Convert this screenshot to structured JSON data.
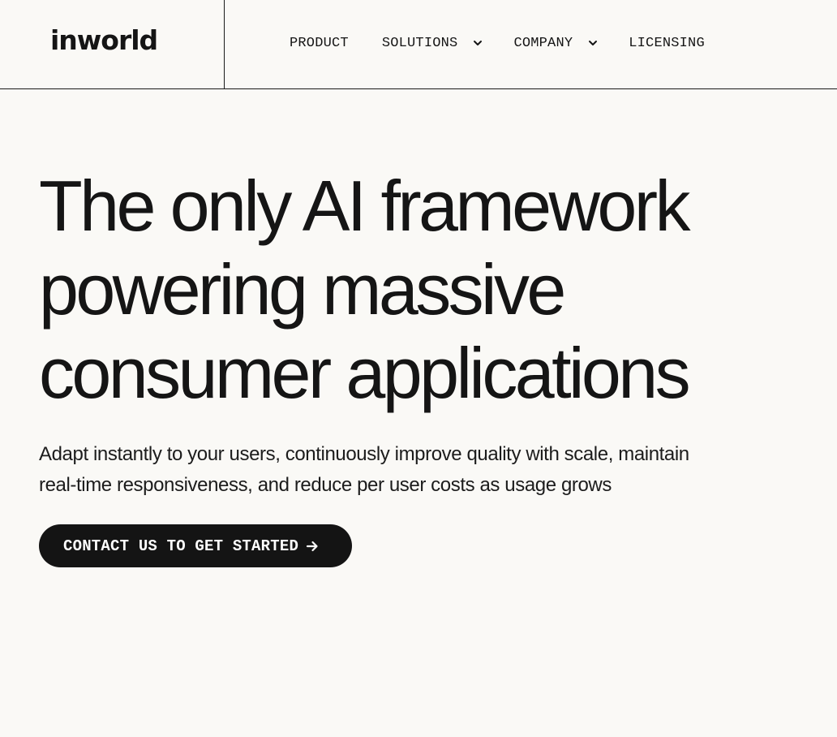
{
  "header": {
    "logo_text": "inworld",
    "nav": [
      {
        "label": "PRODUCT",
        "has_dropdown": false
      },
      {
        "label": "SOLUTIONS",
        "has_dropdown": true,
        "icon": "chevron-down-icon"
      },
      {
        "label": "COMPANY",
        "has_dropdown": true,
        "icon": "chevron-down-icon"
      },
      {
        "label": "LICENSING",
        "has_dropdown": false
      }
    ]
  },
  "hero": {
    "title_lines": [
      "The only AI framework",
      "powering massive",
      "consumer applications"
    ],
    "subtitle_lines": [
      "Adapt instantly to your users, continuously improve quality with scale, maintain",
      "real-time responsiveness, and reduce per user costs as usage grows"
    ],
    "cta_label": "CONTACT US TO GET STARTED",
    "cta_icon": "arrow-right-icon"
  },
  "colors": {
    "background": "#faf9f6",
    "text": "#151515",
    "button_bg": "#141414",
    "button_text": "#ffffff",
    "divider": "#1a1a1a"
  }
}
